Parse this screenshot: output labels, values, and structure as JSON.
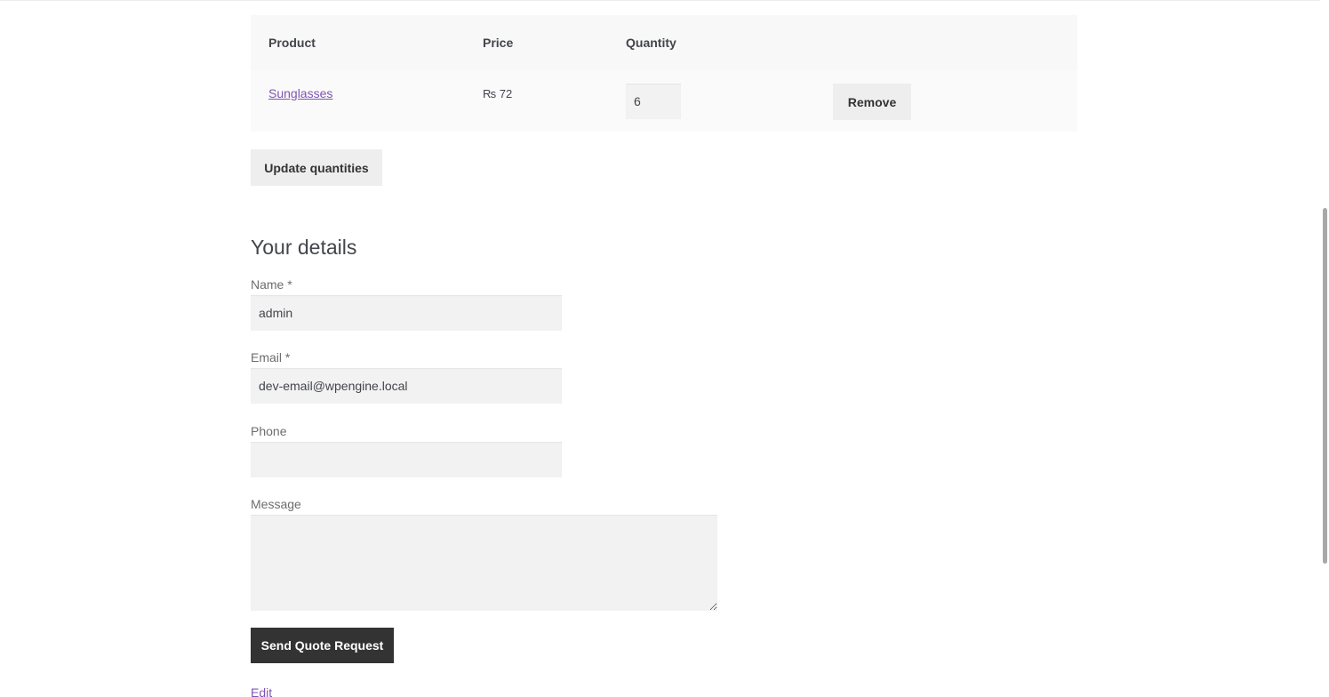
{
  "cart": {
    "headers": {
      "product": "Product",
      "price": "Price",
      "quantity": "Quantity"
    },
    "items": [
      {
        "product": "Sunglasses",
        "price": "₨ 72",
        "quantity": "6",
        "remove_label": "Remove"
      }
    ],
    "update_label": "Update quantities"
  },
  "details": {
    "title": "Your details",
    "name_label": "Name *",
    "name_value": "admin",
    "email_label": "Email *",
    "email_value": "dev-email@wpengine.local",
    "phone_label": "Phone",
    "phone_value": "",
    "message_label": "Message",
    "message_value": "",
    "submit_label": "Send Quote Request",
    "edit_label": "Edit"
  },
  "colors": {
    "link": "#7f54b3",
    "primary_button": "#333333",
    "secondary_button": "#eeeeee",
    "input_background": "#f2f2f2"
  }
}
